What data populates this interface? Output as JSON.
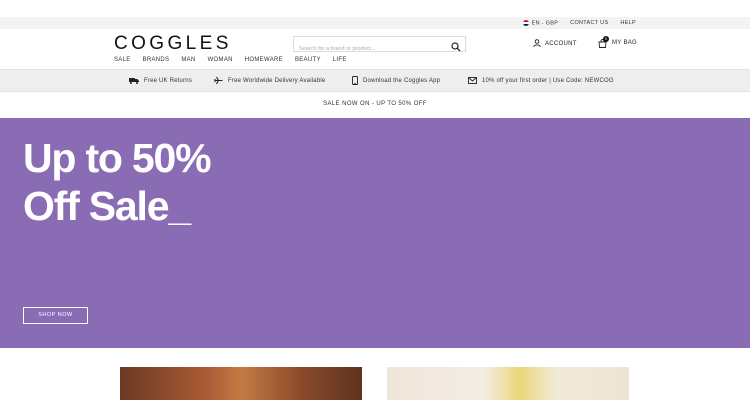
{
  "topbar": {
    "locale": "EN - GBP",
    "contact": "CONTACT US",
    "help": "HELP"
  },
  "brand": {
    "logo": "COGGLES"
  },
  "nav": [
    "SALE",
    "BRANDS",
    "MAN",
    "WOMAN",
    "HOMEWARE",
    "BEAUTY",
    "LIFE"
  ],
  "search": {
    "placeholder": "Search for a brand or product..."
  },
  "account": {
    "label": "ACCOUNT"
  },
  "bag": {
    "label": "MY BAG",
    "count": "0"
  },
  "usp": [
    {
      "icon": "truck-icon",
      "text": "Free UK Returns"
    },
    {
      "icon": "plane-icon",
      "text": "Free Worldwide Delivery Available"
    },
    {
      "icon": "phone-icon",
      "text": "Download the Coggles App"
    },
    {
      "icon": "envelope-icon",
      "text": "10% off your first order | Use Code: NEWCOG"
    }
  ],
  "promo": {
    "text": "SALE NOW ON - UP TO 50% OFF"
  },
  "hero": {
    "line1": "Up to 50%",
    "line2": "Off Sale_",
    "cta": "SHOP NOW",
    "background": "#8a6cb5"
  }
}
